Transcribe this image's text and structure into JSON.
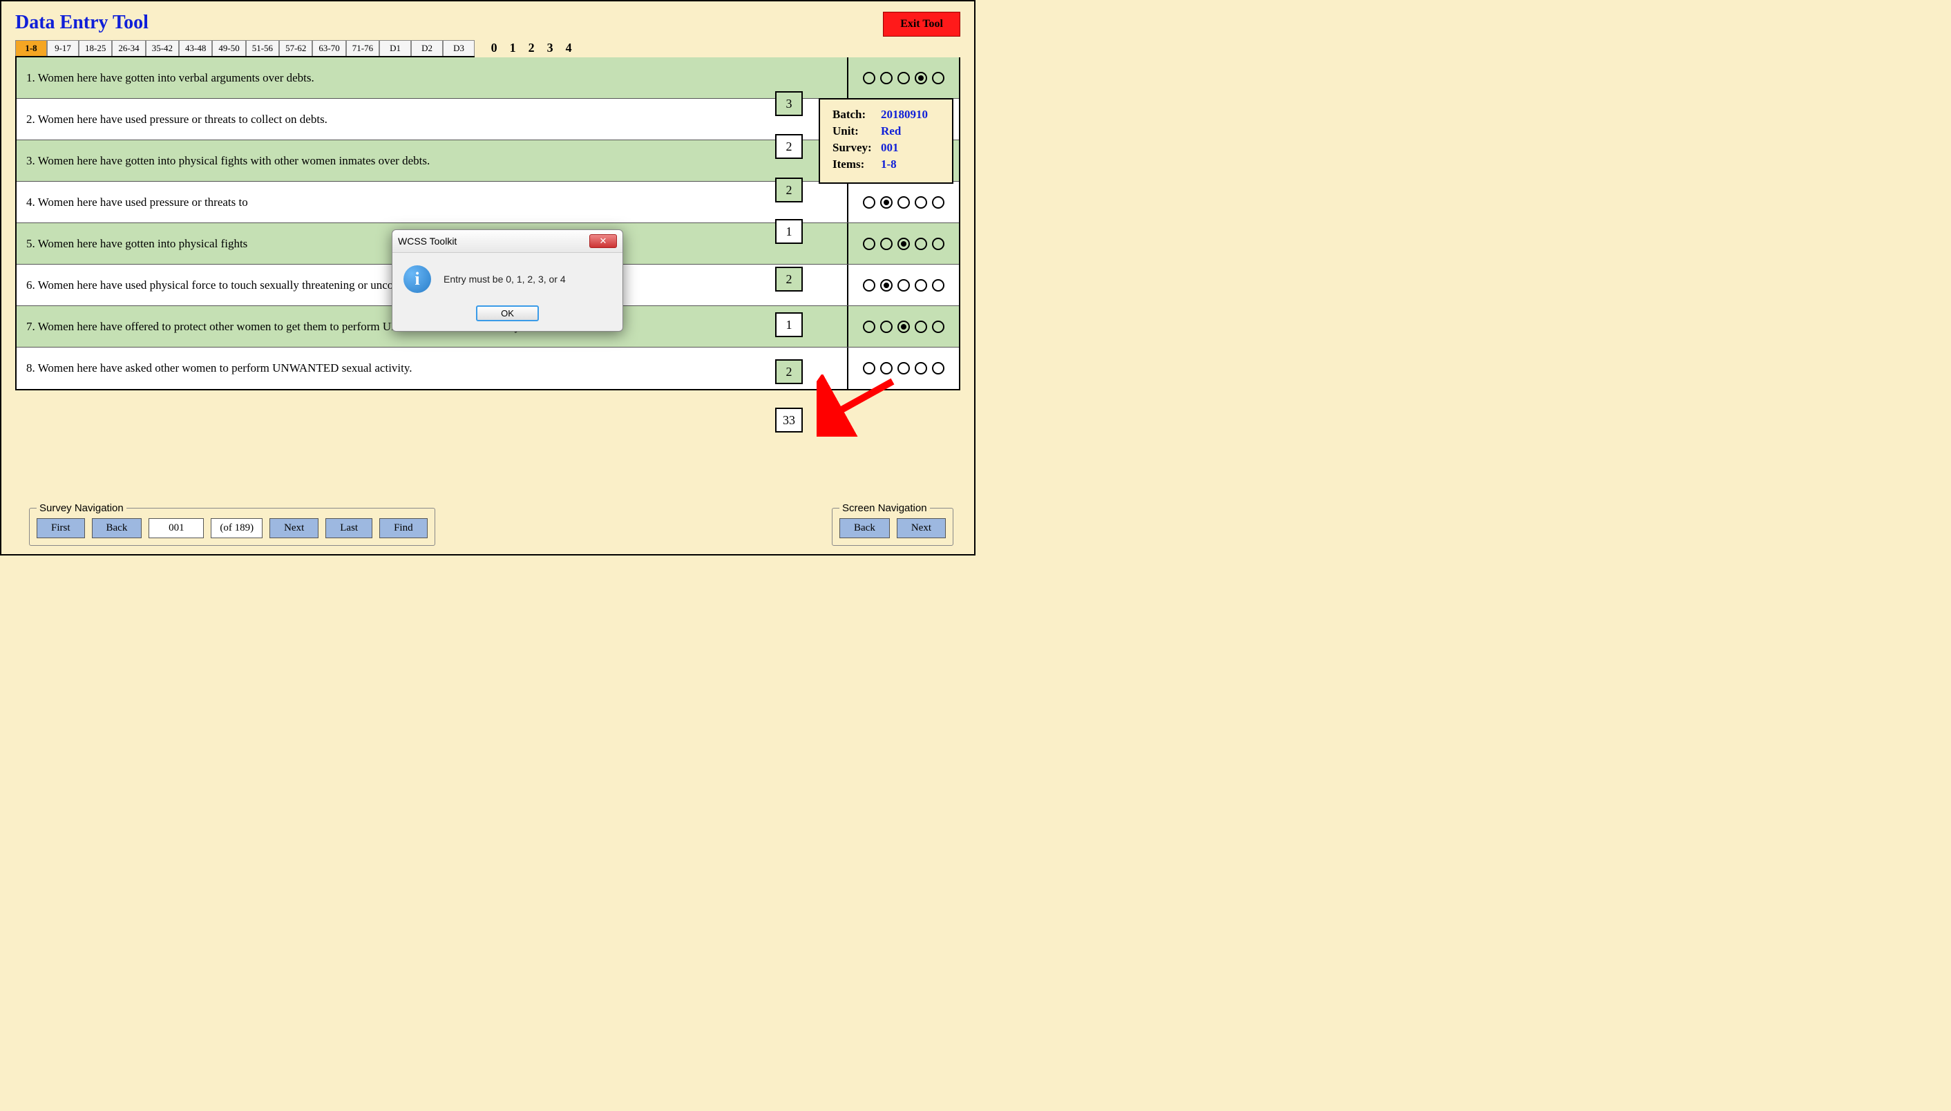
{
  "title": "Data Entry Tool",
  "exit_label": "Exit Tool",
  "tabs": [
    "1-8",
    "9-17",
    "18-25",
    "26-34",
    "35-42",
    "43-48",
    "49-50",
    "51-56",
    "57-62",
    "63-70",
    "71-76",
    "D1",
    "D2",
    "D3"
  ],
  "active_tab": 0,
  "scale": [
    "0",
    "1",
    "2",
    "3",
    "4"
  ],
  "items": [
    {
      "num": "1.",
      "text": "Women here have gotten into verbal arguments over debts.",
      "selected": 3,
      "value": "3",
      "alt": true
    },
    {
      "num": "2.",
      "text": "Women here have used pressure or threats to collect on debts.",
      "selected": 2,
      "value": "2",
      "alt": false
    },
    {
      "num": "3.",
      "text": "Women here have gotten into physical fights with other women inmates over debts.",
      "selected": 2,
      "value": "2",
      "alt": true
    },
    {
      "num": "4.",
      "text": "Women here have used pressure or threats to",
      "selected": 1,
      "value": "1",
      "alt": false
    },
    {
      "num": "5.",
      "text": "Women here have gotten into physical fights",
      "selected": 2,
      "value": "2",
      "alt": true
    },
    {
      "num": "6.",
      "text": "Women here have used physical force to touch                                             sexually threatening or uncomfortable way.",
      "selected": 1,
      "value": "1",
      "alt": false
    },
    {
      "num": "7.",
      "text": "Women here have offered to protect other women to get them to perform UNWANTED sexual activity.",
      "selected": 2,
      "value": "2",
      "alt": true
    },
    {
      "num": "8.",
      "text": "Women here have asked other women to perform UNWANTED sexual activity.",
      "selected": -1,
      "value": "33",
      "alt": false
    }
  ],
  "info": {
    "batch_label": "Batch:",
    "batch": "20180910",
    "unit_label": "Unit:",
    "unit": "Red",
    "survey_label": "Survey:",
    "survey": "001",
    "items_label": "Items:",
    "items": "1-8"
  },
  "dialog": {
    "title": "WCSS Toolkit",
    "message": "Entry must be 0, 1, 2, 3, or 4",
    "ok": "OK",
    "icon": "i"
  },
  "survey_nav": {
    "title": "Survey Navigation",
    "first": "First",
    "back": "Back",
    "current": "001",
    "count": "(of 189)",
    "next": "Next",
    "last": "Last",
    "find": "Find"
  },
  "screen_nav": {
    "title": "Screen Navigation",
    "back": "Back",
    "next": "Next"
  },
  "value_box_offsets": [
    0,
    62,
    125,
    185,
    254,
    320,
    388,
    458
  ]
}
